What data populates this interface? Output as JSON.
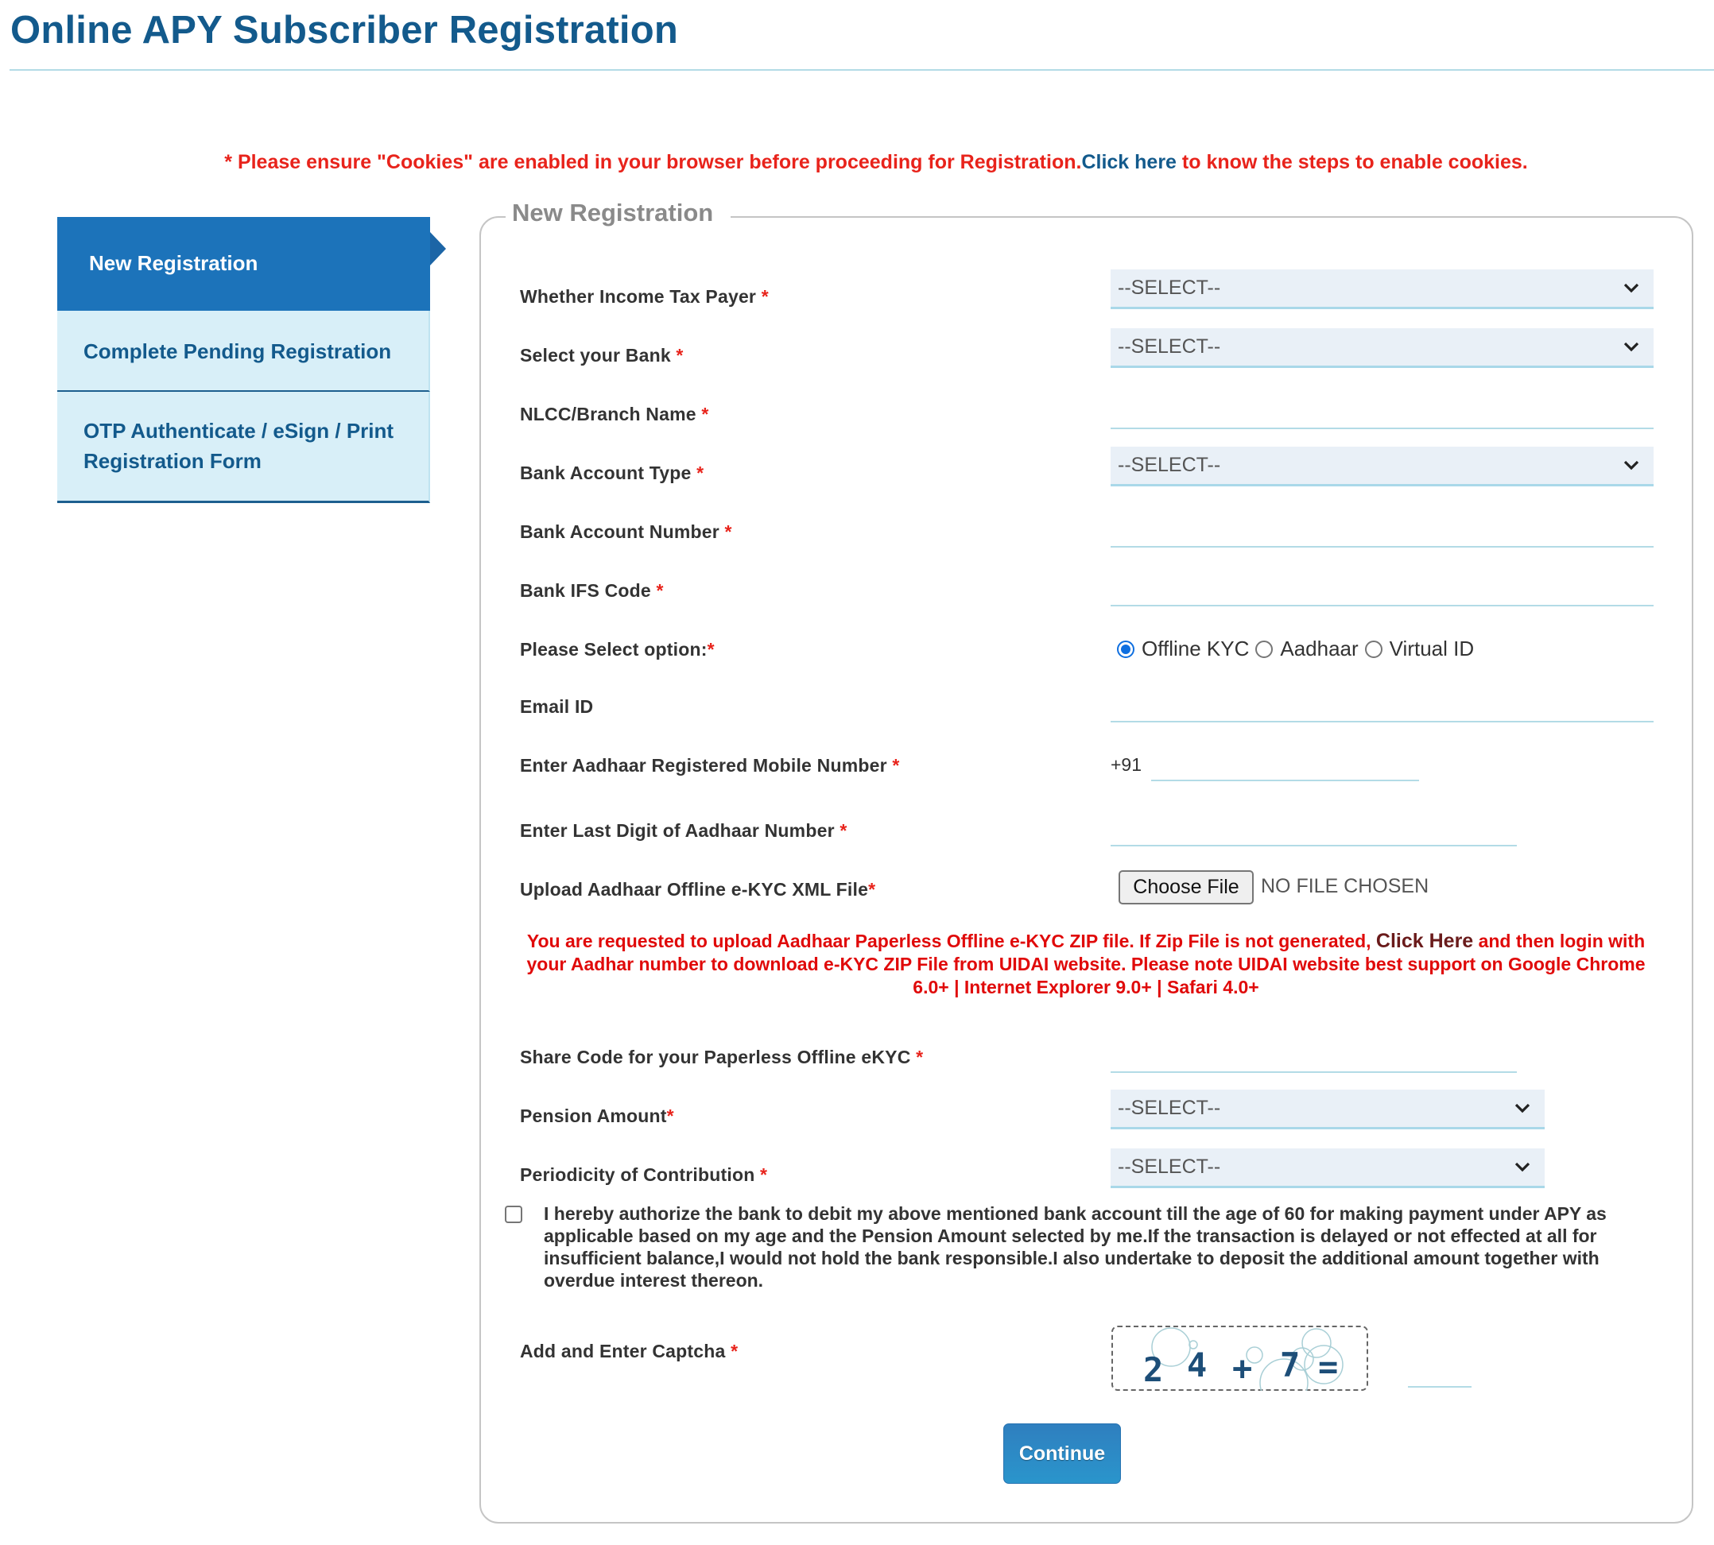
{
  "page": {
    "title": "Online APY Subscriber Registration"
  },
  "notice": {
    "prefix": "* Please ensure \"Cookies\" are enabled in your browser before proceeding for Registration.",
    "link": "Click here",
    "suffix": " to know the steps to enable cookies."
  },
  "sidebar": {
    "items": [
      {
        "label": "New Registration",
        "active": true
      },
      {
        "label": "Complete Pending Registration",
        "active": false
      },
      {
        "label": "OTP Authenticate / eSign / Print Registration Form",
        "active": false
      }
    ]
  },
  "form": {
    "legend": "New Registration",
    "required_mark": "*",
    "fields": {
      "income_tax": {
        "label": "Whether Income Tax Payer",
        "value": "--SELECT--"
      },
      "bank": {
        "label": "Select your Bank",
        "value": "--SELECT--"
      },
      "branch": {
        "label": "NLCC/Branch Name",
        "value": ""
      },
      "account_type": {
        "label": "Bank Account Type",
        "value": "--SELECT--"
      },
      "account_number": {
        "label": "Bank Account Number",
        "value": ""
      },
      "ifsc": {
        "label": "Bank IFS Code",
        "value": ""
      },
      "option": {
        "label": "Please Select option:",
        "choices": [
          "Offline KYC",
          "Aadhaar",
          "Virtual ID"
        ],
        "selected": "Offline KYC"
      },
      "email": {
        "label": "Email ID",
        "value": ""
      },
      "mobile": {
        "label": "Enter Aadhaar Registered Mobile Number",
        "prefix": "+91",
        "value": ""
      },
      "aadhaar_last_digit": {
        "label": "Enter Last Digit of Aadhaar Number",
        "value": ""
      },
      "upload": {
        "label": "Upload Aadhaar Offline e-KYC XML File",
        "button": "Choose File",
        "status": "NO FILE CHOSEN"
      },
      "share_code": {
        "label": "Share Code for your Paperless Offline eKYC",
        "value": ""
      },
      "pension_amount": {
        "label": "Pension Amount",
        "value": "--SELECT--"
      },
      "periodicity": {
        "label": "Periodicity of Contribution",
        "value": "--SELECT--"
      },
      "captcha": {
        "label": "Add and Enter Captcha",
        "expression": [
          "2",
          "4",
          "+",
          "7",
          "="
        ],
        "value": ""
      }
    },
    "upload_warning": {
      "part1": "You are requested to upload Aadhaar Paperless Offline e-KYC ZIP file. If Zip File is not generated, ",
      "link": "Click Here",
      "part2": " and then login with your Aadhar number to download e-KYC ZIP File from UIDAI website. Please note UIDAI website best support on Google Chrome 6.0+ | Internet Explorer 9.0+ | Safari 4.0+"
    },
    "consent": {
      "text": "I hereby authorize the bank to debit my above mentioned bank account till the age of 60 for making payment under APY as applicable based on my age and the Pension Amount selected by me.If the transaction is delayed or not effected at all for insufficient balance,I would not hold the bank responsible.I also undertake to deposit the additional amount together with overdue interest thereon.",
      "checked": false
    },
    "continue_label": "Continue"
  },
  "colors": {
    "brand": "#135a8c",
    "active_tab": "#1c73ba",
    "alert": "#e8231b",
    "button": "#2a8ac6"
  }
}
